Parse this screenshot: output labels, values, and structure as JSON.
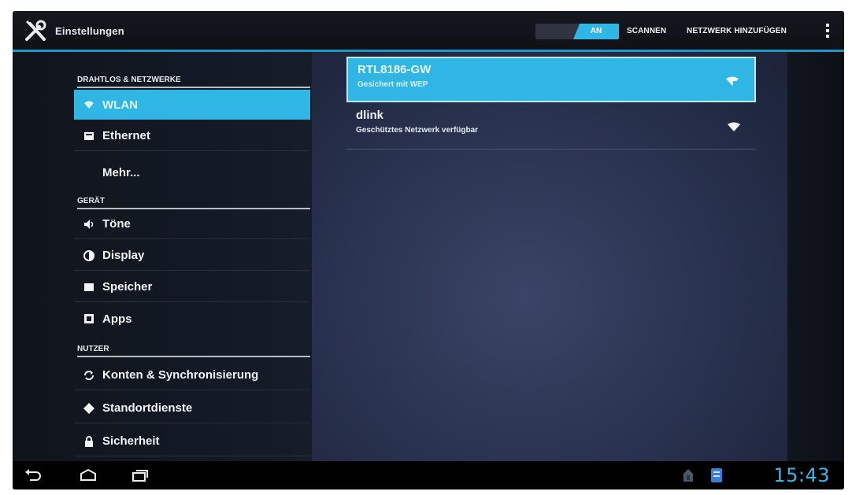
{
  "app": {
    "title": "Einstellungen"
  },
  "actionbar": {
    "wifi_toggle": "AN",
    "scan_label": "SCANNEN",
    "add_network_label": "NETZWERK HINZUFÜGEN",
    "overflow_icon": "overflow-menu-icon"
  },
  "sidebar": {
    "sections": [
      {
        "header": "DRAHTLOS & NETZWERKE"
      },
      {
        "header": "GERÄT"
      },
      {
        "header": "NUTZER"
      }
    ],
    "items": [
      {
        "label": "WLAN",
        "icon": "wifi-icon",
        "selected": true
      },
      {
        "label": "Ethernet",
        "icon": "ethernet-icon",
        "selected": false
      },
      {
        "label": "Mehr...",
        "icon": "",
        "selected": false
      },
      {
        "label": "Töne",
        "icon": "volume-icon",
        "selected": false
      },
      {
        "label": "Display",
        "icon": "display-icon",
        "selected": false
      },
      {
        "label": "Speicher",
        "icon": "storage-icon",
        "selected": false
      },
      {
        "label": "Apps",
        "icon": "apps-icon",
        "selected": false
      },
      {
        "label": "Konten & Synchronisierung",
        "icon": "sync-icon",
        "selected": false
      },
      {
        "label": "Standortdienste",
        "icon": "location-icon",
        "selected": false
      },
      {
        "label": "Sicherheit",
        "icon": "lock-icon",
        "selected": false
      }
    ]
  },
  "networks": [
    {
      "ssid": "RTL8186-GW",
      "status": "Gesichert mit WEP",
      "selected": true,
      "icon": "wifi-signal-locked-icon"
    },
    {
      "ssid": "dlink",
      "status": "Geschütztes Netzwerk verfügbar",
      "selected": false,
      "icon": "wifi-signal-icon"
    }
  ],
  "navbar": {
    "back_icon": "back-icon",
    "home_icon": "home-icon",
    "recents_icon": "recent-apps-icon",
    "clock": "15:43"
  },
  "colors": {
    "accent": "#2fb6e4",
    "actionbar_underline": "#1f97c6",
    "clock": "#35b8e8"
  }
}
